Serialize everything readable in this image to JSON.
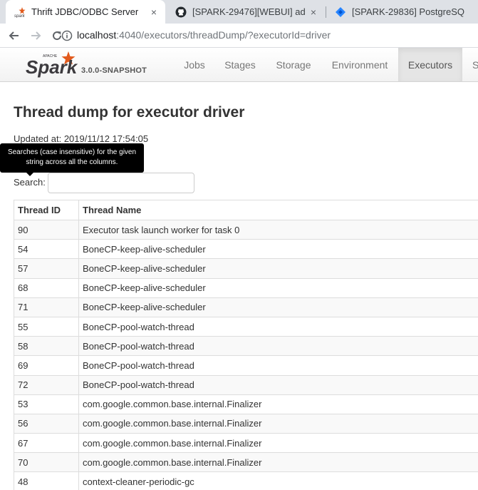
{
  "browser": {
    "tabs": [
      {
        "title": "Thrift JDBC/ODBC Server",
        "favicon": "spark-icon",
        "active": true
      },
      {
        "title": "[SPARK-29476][WEBUI] ad",
        "favicon": "github-icon",
        "active": false
      },
      {
        "title": "[SPARK-29836] PostgreSQ",
        "favicon": "jira-icon",
        "active": false
      }
    ],
    "close_glyph": "×",
    "url_host": "localhost",
    "url_rest": ":4040/executors/threadDump/?executorId=driver"
  },
  "spark": {
    "version": "3.0.0-SNAPSHOT",
    "nav": [
      "Jobs",
      "Stages",
      "Storage",
      "Environment",
      "Executors",
      "S"
    ],
    "active_nav": "Executors",
    "colors": {
      "logo_orange": "#e25a1c",
      "logo_text": "#3c3a3e"
    }
  },
  "page": {
    "title": "Thread dump for executor driver",
    "updated": "Updated at: 2019/11/12 17:54:05",
    "tooltip": "Searches (case insensitive) for the given string across all the columns.",
    "search_label": "Search:",
    "search_value": ""
  },
  "table": {
    "headers": [
      "Thread ID",
      "Thread Name"
    ],
    "rows": [
      [
        "90",
        "Executor task launch worker for task 0"
      ],
      [
        "54",
        "BoneCP-keep-alive-scheduler"
      ],
      [
        "57",
        "BoneCP-keep-alive-scheduler"
      ],
      [
        "68",
        "BoneCP-keep-alive-scheduler"
      ],
      [
        "71",
        "BoneCP-keep-alive-scheduler"
      ],
      [
        "55",
        "BoneCP-pool-watch-thread"
      ],
      [
        "58",
        "BoneCP-pool-watch-thread"
      ],
      [
        "69",
        "BoneCP-pool-watch-thread"
      ],
      [
        "72",
        "BoneCP-pool-watch-thread"
      ],
      [
        "53",
        "com.google.common.base.internal.Finalizer"
      ],
      [
        "56",
        "com.google.common.base.internal.Finalizer"
      ],
      [
        "67",
        "com.google.common.base.internal.Finalizer"
      ],
      [
        "70",
        "com.google.common.base.internal.Finalizer"
      ],
      [
        "48",
        "context-cleaner-periodic-gc"
      ]
    ]
  }
}
